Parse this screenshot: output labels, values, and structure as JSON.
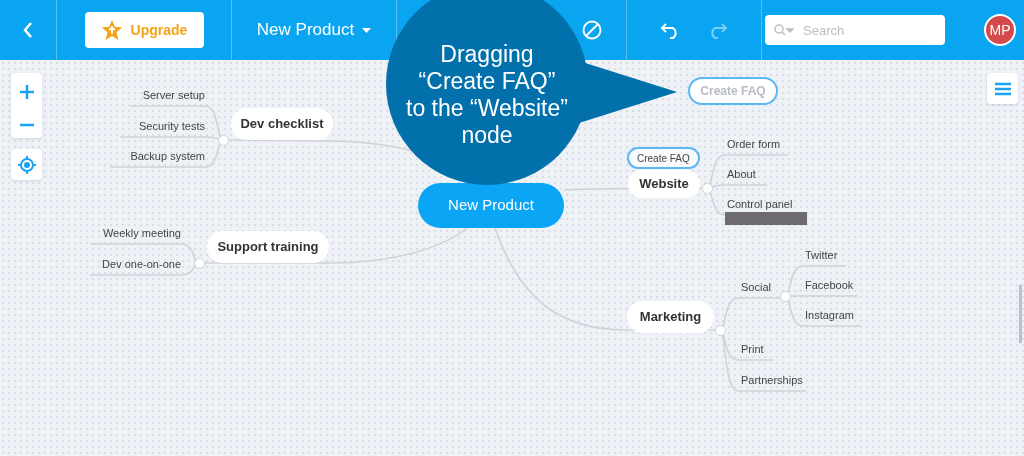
{
  "toolbar": {
    "upgrade_label": "Upgrade",
    "map_title": "New Product",
    "undo_disabled": false,
    "redo_disabled": true,
    "search_placeholder": "Search",
    "avatar_initials": "MP"
  },
  "callout": {
    "lines": [
      "Dragging",
      "“Create FAQ”",
      "to the “Website”",
      "node"
    ]
  },
  "dragged_node": {
    "label": "Create FAQ"
  },
  "mind_map": {
    "root": "New Product",
    "branches": [
      {
        "label": "Dev checklist",
        "children": [
          {
            "label": "Server setup"
          },
          {
            "label": "Security tests"
          },
          {
            "label": "Backup system"
          }
        ]
      },
      {
        "label": "Support training",
        "children": [
          {
            "label": "Weekly meeting"
          },
          {
            "label": "Dev one-on-one"
          }
        ]
      },
      {
        "label": "Website",
        "drop_preview": "Create FAQ",
        "children": [
          {
            "label": "Order form"
          },
          {
            "label": "About"
          },
          {
            "label": "Control panel"
          }
        ]
      },
      {
        "label": "Marketing",
        "children": [
          {
            "label": "Social",
            "children": [
              {
                "label": "Twitter"
              },
              {
                "label": "Facebook"
              },
              {
                "label": "Instagram"
              }
            ]
          },
          {
            "label": "Print"
          },
          {
            "label": "Partnerships"
          }
        ]
      }
    ]
  }
}
